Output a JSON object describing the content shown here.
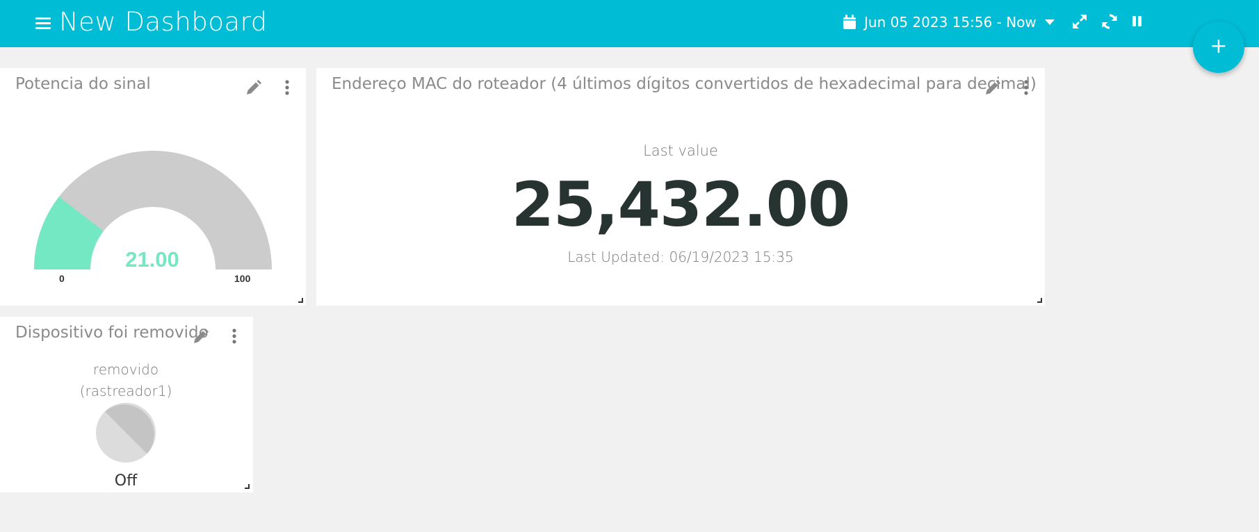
{
  "header": {
    "title": "New Dashboard",
    "date_range": "Jun 05 2023 15:56 - Now",
    "add_button_label": "+"
  },
  "icons": {
    "menu": "menu-icon",
    "calendar": "calendar-icon",
    "caret": "caret-down-icon",
    "fullscreen": "expand-icon",
    "refresh": "refresh-icon",
    "pause": "pause-icon",
    "edit": "pencil-icon",
    "more": "more-vertical-icon"
  },
  "colors": {
    "accent": "#00bcd4",
    "gauge_fill": "#74e8c2",
    "gauge_track": "#cccccc",
    "background": "#f1f1f1"
  },
  "widgets": {
    "gauge": {
      "title": "Potencia do sinal",
      "value": 21.0,
      "value_display": "21.00",
      "min": 0,
      "max": 100,
      "min_label": "0",
      "max_label": "100"
    },
    "last_value": {
      "title": "Endereço MAC do roteador (4 últimos dígitos convertidos de hexadecimal para decimal)",
      "label": "Last value",
      "value": "25,432.00",
      "updated": "Last Updated: 06/19/2023 15:35"
    },
    "indicator": {
      "title": "Dispositivo foi removido",
      "label_line1": "removido",
      "label_line2": "(rastreador1)",
      "state": "Off"
    }
  }
}
